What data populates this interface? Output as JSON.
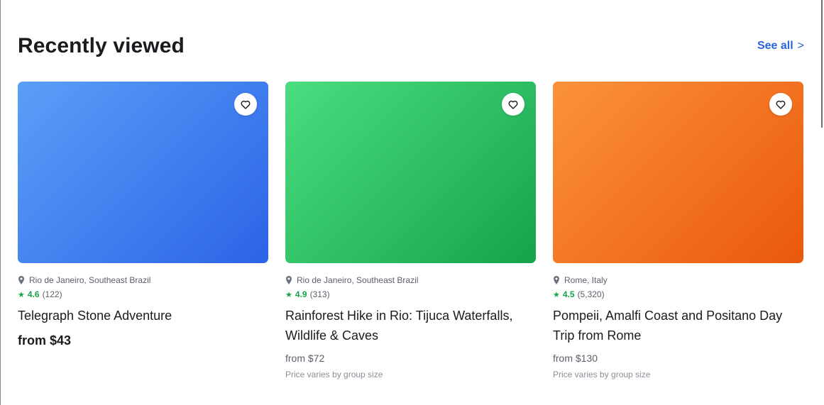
{
  "section": {
    "title": "Recently viewed",
    "see_all_label": "See all",
    "see_all_chevron": ">"
  },
  "cards": [
    {
      "image_color": "#3b82f6",
      "location": "Rio de Janeiro, Southeast Brazil",
      "rating_value": "4.6",
      "review_count": "(122)",
      "title": "Telegraph Stone Adventure",
      "price": "from $43",
      "price_note": ""
    },
    {
      "image_color": "#22c55e",
      "location": "Rio de Janeiro, Southeast Brazil",
      "rating_value": "4.9",
      "review_count": "(313)",
      "title": "Rainforest Hike in Rio: Tijuca Waterfalls, Wildlife & Caves",
      "price": "from $72",
      "price_note": "Price varies by group size"
    },
    {
      "image_color": "#f97316",
      "location": "Rome, Italy",
      "rating_value": "4.5",
      "review_count": "(5,320)",
      "title": "Pompeii, Amalfi Coast and Positano Day Trip from Rome",
      "price": "from $130",
      "price_note": "Price varies by group size"
    }
  ],
  "icons": {
    "wishlist": "heart-icon",
    "location": "map-pin-icon",
    "rating": "star-icon"
  },
  "colors": {
    "accent_link": "#2b64d8",
    "rating_green": "#16a34a"
  }
}
